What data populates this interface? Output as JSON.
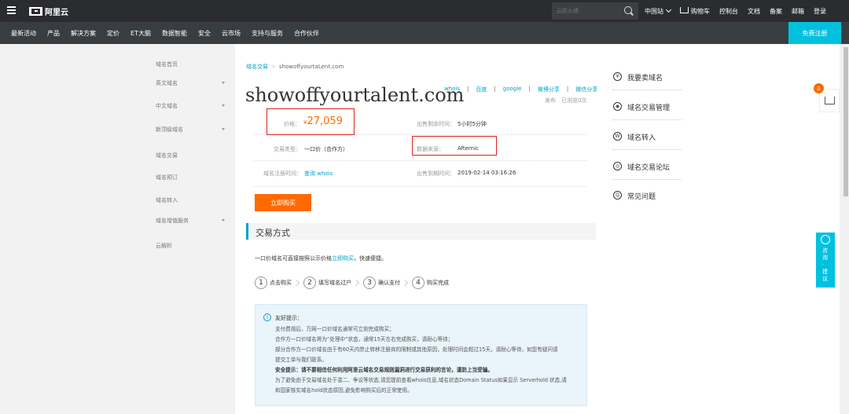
{
  "topbar": {
    "logo_text": "阿里云",
    "search_placeholder": "云防火墙",
    "items": [
      "中国站",
      "购物车",
      "控制台",
      "文档",
      "备案",
      "邮箱",
      "登录"
    ]
  },
  "navbar": {
    "items": [
      "最新活动",
      "产品",
      "解决方案",
      "定价",
      "ET大脑",
      "数据智能",
      "安全",
      "云市场",
      "支持与服务",
      "合作伙伴"
    ],
    "register": "免费注册"
  },
  "sidebar": {
    "items": [
      {
        "label": "域名首页",
        "expandable": false
      },
      {
        "label": "英文域名",
        "expandable": true
      },
      {
        "label": "中文域名",
        "expandable": true
      },
      {
        "label": "新顶级域名",
        "expandable": true
      },
      {
        "label": "域名交易",
        "expandable": false
      },
      {
        "label": "域名预订",
        "expandable": false
      },
      {
        "label": "域名转入",
        "expandable": false
      },
      {
        "label": "域名增值服务",
        "expandable": true
      },
      {
        "label": "云解析",
        "expandable": false
      }
    ]
  },
  "breadcrumb": {
    "root": "域名交易",
    "separator": ">",
    "current": "showoffyourtaLent.com"
  },
  "domain": {
    "title": "showoffyourtalent.com",
    "share": [
      "whois",
      "百度",
      "google",
      "微博分享",
      "微信分享"
    ],
    "share_sep": "|",
    "meta": [
      "发布",
      "已浏览0次"
    ]
  },
  "details": {
    "price_label": "价格：",
    "price_currency": "¥",
    "price_value": "27,059",
    "remaining_label": "出售剩余时间：",
    "remaining_value": "5小时5分钟",
    "type_label": "交易类型：",
    "type_value": "一口价（合作方）",
    "source_label": "数据来源：",
    "source_value": "Afternic",
    "reg_label": "域名注册时间：",
    "reg_value": "查询 whois",
    "expire_label": "出售到期时间：",
    "expire_value": "2019-02-14 03:16:26"
  },
  "buy_button": "立即购买",
  "section": {
    "title": "交易方式",
    "intro_prefix": "一口价域名可直接按照公示价格",
    "intro_link": "立即购买",
    "intro_suffix": "，快速便捷。"
  },
  "steps": [
    {
      "num": "1",
      "label": "点击购买"
    },
    {
      "num": "2",
      "label": "填写域名过户"
    },
    {
      "num": "3",
      "label": "确认支付"
    },
    {
      "num": "4",
      "label": "购买完成"
    }
  ],
  "tips": {
    "title": "友好提示：",
    "lines": [
      "支付费用后，万网一口价域名通常可立刻完成购买；",
      "合作方一口价域名将为“处理中”状态，通常15天左右完成购买，请耐心等待；",
      "部分合作方一口价域名由于有60天内禁止转移注册商的限制或其他原因，处理时间会超过15天，请耐心等待，如您有疑问请",
      "提交工单与我们联系。",
      "安全提示：请不要相信任何利用阿里云域名交易规则漏洞进行交易获利的言论，谨防上当受骗。",
      "为了避免由于交易域名处于滥二、争议等状态,请您提前查看whois信息,域名状态Domain Status如果显示 Serverhold 状态,请",
      "和国家核实域名hold状态原因,避免影响购买后的正常使用。"
    ]
  },
  "right_menu": [
    {
      "icon": "¥",
      "label": "我要卖域名"
    },
    {
      "icon": "◉",
      "label": "域名交易管理"
    },
    {
      "icon": "W",
      "label": "域名转入"
    },
    {
      "icon": "◎",
      "label": "域名交易论坛"
    },
    {
      "icon": "Q",
      "label": "常见问题"
    }
  ],
  "cart_badge": "0",
  "feedback": "咨询·建议",
  "colors": {
    "accent": "#00c1de",
    "link": "#00a2ca",
    "price": "#ff6a00",
    "highlight_box": "#e02020"
  }
}
